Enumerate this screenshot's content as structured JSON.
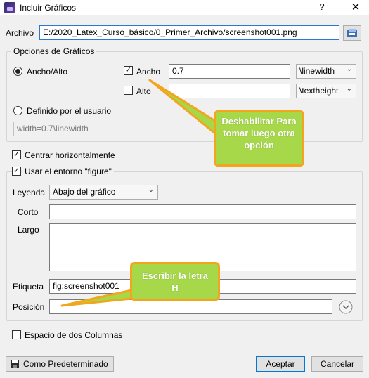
{
  "window": {
    "title": "Incluir Gráficos",
    "help_label": "?",
    "close_label": "✕"
  },
  "archivo": {
    "label": "Archivo",
    "value": "E:/2020_Latex_Curso_básico/0_Primer_Archivo/screenshot001.png",
    "browse_icon": "folder-browse-icon"
  },
  "opciones": {
    "title": "Opciones de Gráficos",
    "radio_ancho_alto": "Ancho/Alto",
    "ancho_label": "Ancho",
    "ancho_checked": true,
    "ancho_value": "0.7",
    "ancho_unit": "\\linewidth",
    "alto_label": "Alto",
    "alto_checked": false,
    "alto_value": "",
    "alto_unit": "\\textheight",
    "radio_usuario": "Definido por el usuario",
    "usuario_value": "width=0.7\\linewidth"
  },
  "centrar": {
    "label": "Centrar horizontalmente",
    "checked": true
  },
  "figure_env": {
    "label": "Usar el entorno \"figure\"",
    "checked": true,
    "leyenda_label": "Leyenda",
    "leyenda_value": "Abajo del gráfico",
    "corto_label": "Corto",
    "corto_value": "",
    "largo_label": "Largo",
    "largo_value": "",
    "etiqueta_label": "Etiqueta",
    "etiqueta_value": "fig:screenshot001",
    "posicion_label": "Posición",
    "posicion_value": ""
  },
  "dos_columnas": {
    "label": "Espacio de dos Columnas",
    "checked": false
  },
  "buttons": {
    "default_label": "Como Predeterminado",
    "accept_label": "Aceptar",
    "cancel_label": "Cancelar"
  },
  "callouts": {
    "first": "Deshabilitar Para tomar luego otra opción",
    "second": "Escribir la letra H"
  },
  "colors": {
    "callout_fill": "#a6d84a",
    "callout_border": "#f2a51d",
    "focus_border": "#2b78d4"
  }
}
